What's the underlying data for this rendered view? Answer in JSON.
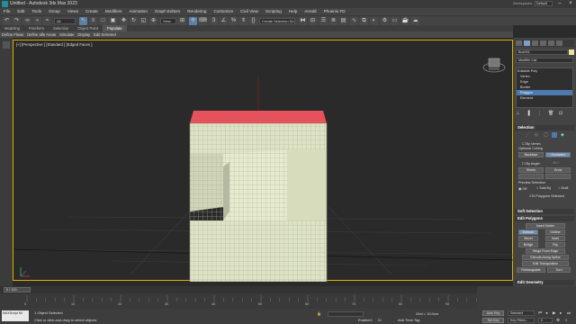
{
  "window": {
    "title": "Untitled - Autodesk 3ds Max 2023",
    "workspace_label": "Workspaces:",
    "workspace_value": "Default"
  },
  "menu": [
    "File",
    "Edit",
    "Tools",
    "Group",
    "Views",
    "Create",
    "Modifiers",
    "Animation",
    "Graph Editors",
    "Rendering",
    "Customize",
    "Civil View",
    "Scripting",
    "Help",
    "Arnold",
    "Phoenix FD"
  ],
  "toolbar": {
    "filter": "All",
    "view": "View",
    "selection_set": "Create Selection Se"
  },
  "ribbon": {
    "tabs": [
      "Modeling",
      "Freeform",
      "Selection",
      "Object Paint",
      "Populate"
    ],
    "active_tab": "Populate",
    "items": [
      "Define Flows",
      "Define Idle Areas",
      "Simulate",
      "Display",
      "Edit Selected"
    ]
  },
  "viewport": {
    "label": "[+] [Perspective ] [Standard ] [Edged Faces ]"
  },
  "command_panel": {
    "object_name": "Box001",
    "modifier_list": "Modifier List",
    "stack": [
      {
        "label": "Editable Poly"
      },
      {
        "label": "Vertex"
      },
      {
        "label": "Edge"
      },
      {
        "label": "Border"
      },
      {
        "label": "Polygon"
      },
      {
        "label": "Element"
      }
    ],
    "active_stack": "Polygon",
    "selection": {
      "title": "Selection",
      "by_vertex": "By Vertex",
      "optional_culling": "Optional Culling",
      "backface": "Backface",
      "occluded": "Occluded",
      "by_angle": "By Angle:",
      "angle": "45.0",
      "shrink": "Shrink",
      "grow": "Grow",
      "preview_label": "Preview Selection",
      "preview_options": [
        "Off",
        "SubObj",
        "Multi"
      ],
      "count_text": "176 Polygons Selected"
    },
    "soft_selection": {
      "title": "Soft Selection"
    },
    "edit_polygons": {
      "title": "Edit Polygons",
      "insert_vertex": "Insert Vertex",
      "extrude": "Extrude",
      "outline": "Outline",
      "bevel": "Bevel",
      "inset": "Inset",
      "bridge": "Bridge",
      "flip": "Flip",
      "hinge": "Hinge From Edge",
      "extrude_spline": "Extrude Along Spline",
      "edit_tri": "Edit Triangulation",
      "retriangulate": "Retriangulate",
      "turn": "Turn"
    },
    "edit_geometry": {
      "title": "Edit Geometry"
    }
  },
  "timeline": {
    "frame": "0 / 100",
    "ticks": [
      "0",
      "10",
      "20",
      "30",
      "40",
      "50",
      "60",
      "70",
      "80",
      "90",
      "100"
    ]
  },
  "status": {
    "script_label": "MAXScript Mi",
    "objects": "1 Object Selected",
    "prompt": "Click or click-and-drag to select objects",
    "grid": "Grid = 10.0cm",
    "enabled": "Enabled:",
    "add_time_tag": "Add Time Tag",
    "auto_key": "Auto Key",
    "auto_key_value": "Selected",
    "set_key": "Set Key",
    "key_filters": "Key Filters...",
    "frame_field": "0"
  },
  "colors": {
    "selected_face": "#e8505a",
    "mesh": "#dde3c3",
    "viewport_bg": "#2a2a2a",
    "accent": "#e0b000",
    "active_blue": "#4d79ad"
  }
}
